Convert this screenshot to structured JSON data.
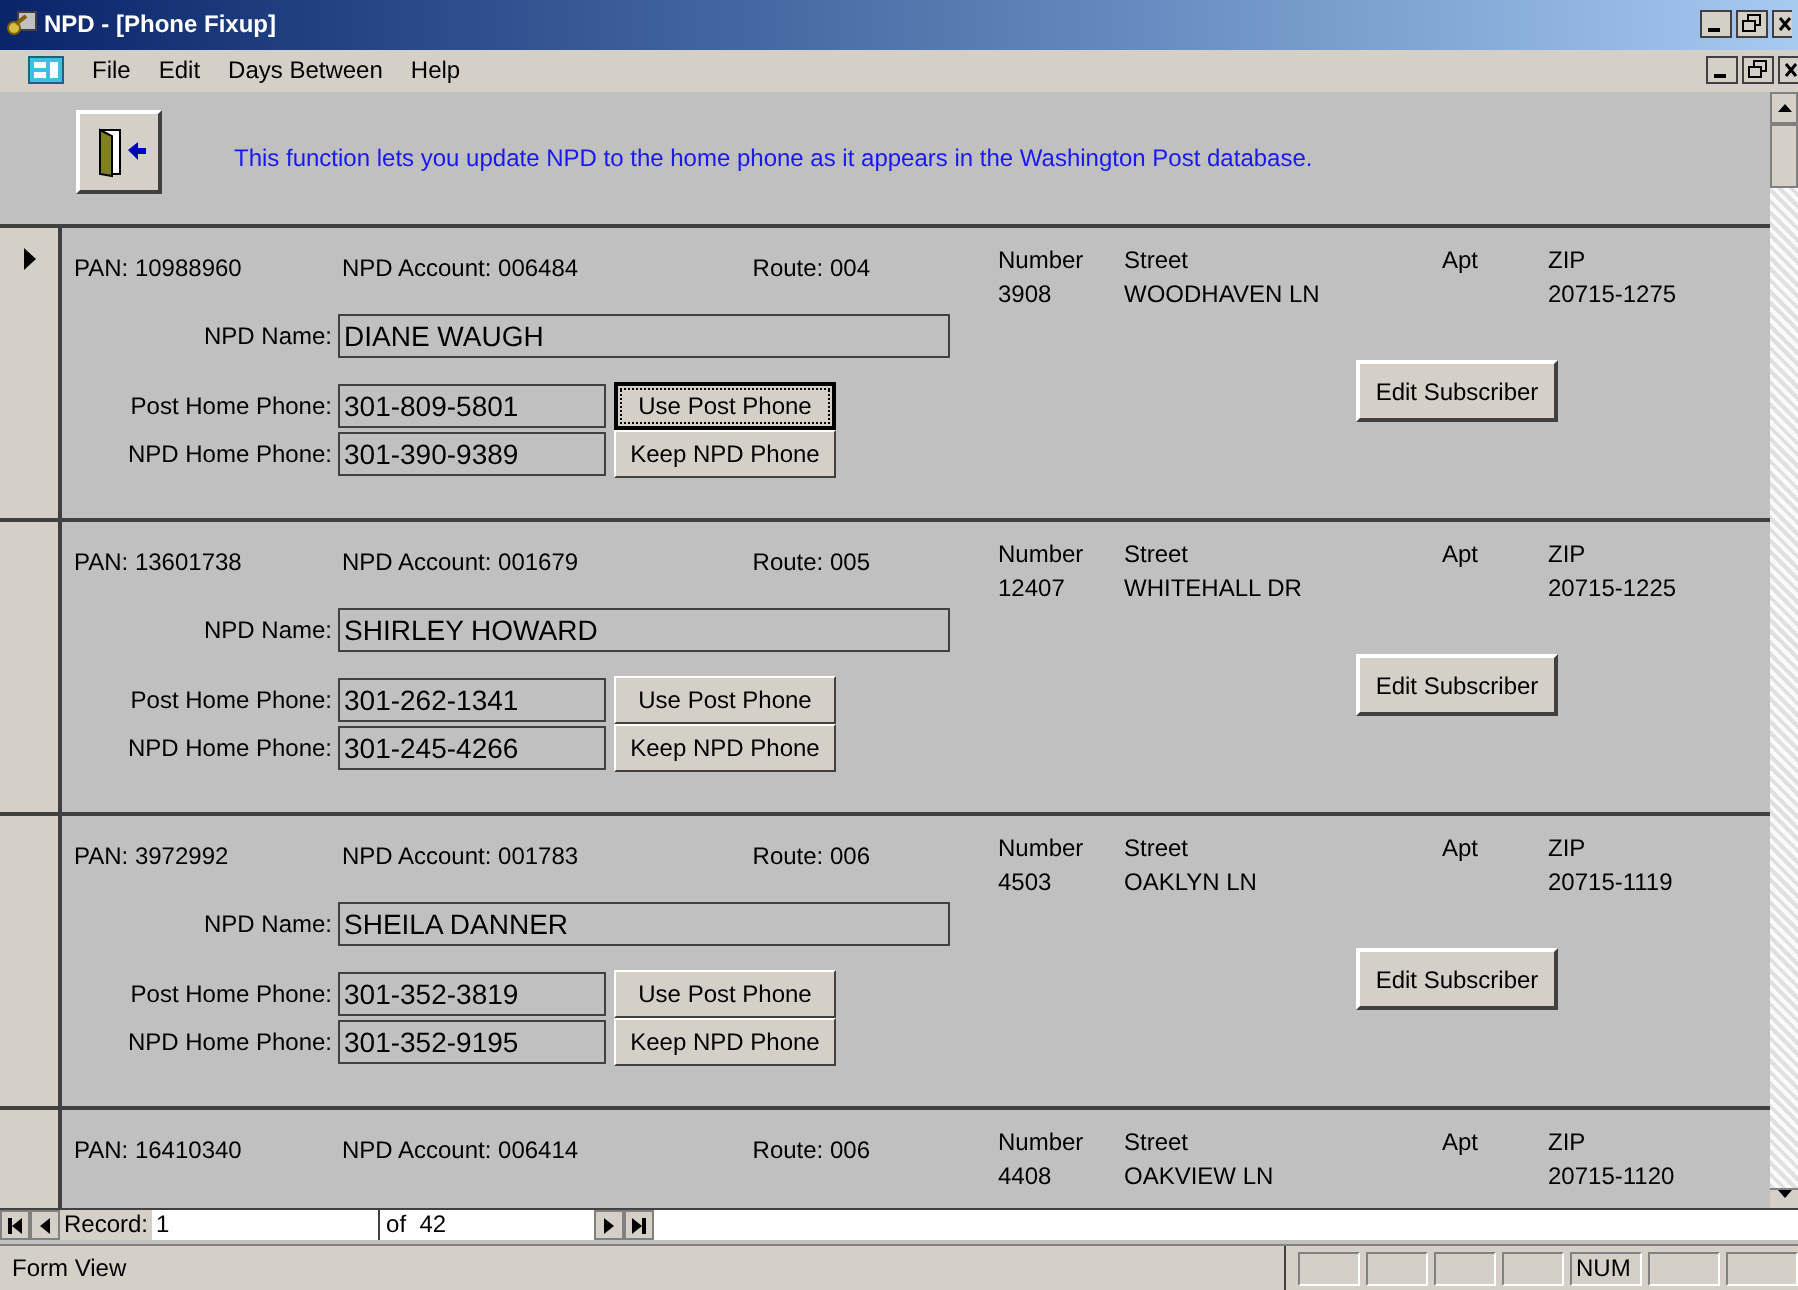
{
  "window": {
    "title": "NPD - [Phone Fixup]"
  },
  "menu": [
    "File",
    "Edit",
    "Days Between",
    "Help"
  ],
  "header": {
    "description": "This function lets you update NPD to the home phone as it appears in the Washington Post database."
  },
  "records": [
    {
      "current": true,
      "pan": "PAN: 10988960",
      "account": "NPD Account: 006484",
      "route": "Route: 004",
      "address": [
        {
          "header": "Number",
          "value": "3908"
        },
        {
          "header": "Street",
          "value": "WOODHAVEN LN"
        },
        {
          "header": "Apt"
        },
        {
          "header": "ZIP",
          "value": "20715-1275"
        }
      ],
      "name": {
        "label": "NPD Name:",
        "value": "DIANE WAUGH"
      },
      "phones": [
        {
          "label": "Post Home Phone:",
          "value": "301-809-5801",
          "button": "Use Post Phone",
          "focused": true
        },
        {
          "label": "NPD Home Phone:",
          "value": "301-390-9389",
          "button": "Keep NPD Phone",
          "focused": false
        }
      ],
      "edit_button": "Edit Subscriber"
    },
    {
      "current": false,
      "pan": "PAN: 13601738",
      "account": "NPD Account: 001679",
      "route": "Route: 005",
      "address": [
        {
          "header": "Number",
          "value": "12407"
        },
        {
          "header": "Street",
          "value": "WHITEHALL DR"
        },
        {
          "header": "Apt"
        },
        {
          "header": "ZIP",
          "value": "20715-1225"
        }
      ],
      "name": {
        "label": "NPD Name:",
        "value": "SHIRLEY HOWARD"
      },
      "phones": [
        {
          "label": "Post Home Phone:",
          "value": "301-262-1341",
          "button": "Use Post Phone",
          "focused": false
        },
        {
          "label": "NPD Home Phone:",
          "value": "301-245-4266",
          "button": "Keep NPD Phone",
          "focused": false
        }
      ],
      "edit_button": "Edit Subscriber"
    },
    {
      "current": false,
      "pan": "PAN: 3972992",
      "account": "NPD Account: 001783",
      "route": "Route: 006",
      "address": [
        {
          "header": "Number",
          "value": "4503"
        },
        {
          "header": "Street",
          "value": "OAKLYN LN"
        },
        {
          "header": "Apt"
        },
        {
          "header": "ZIP",
          "value": "20715-1119"
        }
      ],
      "name": {
        "label": "NPD Name:",
        "value": "SHEILA DANNER"
      },
      "phones": [
        {
          "label": "Post Home Phone:",
          "value": "301-352-3819",
          "button": "Use Post Phone",
          "focused": false
        },
        {
          "label": "NPD Home Phone:",
          "value": "301-352-9195",
          "button": "Keep NPD Phone",
          "focused": false
        }
      ],
      "edit_button": "Edit Subscriber"
    },
    {
      "current": false,
      "pan": "PAN: 16410340",
      "account": "NPD Account: 006414",
      "route": "Route: 006",
      "address": [
        {
          "header": "Number",
          "value": "4408"
        },
        {
          "header": "Street",
          "value": "OAKVIEW LN"
        },
        {
          "header": "Apt"
        },
        {
          "header": "ZIP",
          "value": "20715-1120"
        }
      ]
    }
  ],
  "navigator": {
    "label": "Record:",
    "value": "1",
    "total": "of  42"
  },
  "status_bar": {
    "text": "Form View",
    "indicators": [
      "NUM"
    ]
  }
}
